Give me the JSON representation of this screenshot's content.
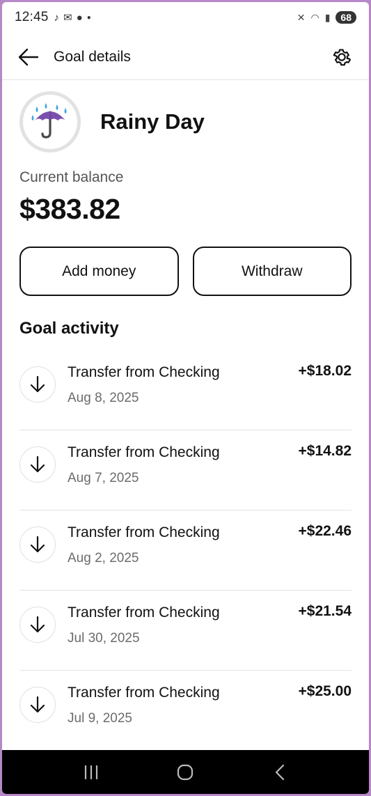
{
  "status_bar": {
    "time": "12:45",
    "battery": "68",
    "notification_icons": [
      "tiktok-icon",
      "mail-icon",
      "reddit-icon",
      "dot-icon"
    ],
    "system_icons": [
      "mute-icon",
      "wifi-icon",
      "signal-icon"
    ]
  },
  "app_bar": {
    "title": "Goal details"
  },
  "goal": {
    "name": "Rainy Day",
    "icon": "umbrella-rain-icon",
    "balance_label": "Current balance",
    "balance": "$383.82"
  },
  "actions": {
    "add_money_label": "Add money",
    "withdraw_label": "Withdraw"
  },
  "activity": {
    "title": "Goal activity",
    "items": [
      {
        "title": "Transfer from Checking",
        "date": "Aug 8, 2025",
        "amount": "+$18.02"
      },
      {
        "title": "Transfer from Checking",
        "date": "Aug 7, 2025",
        "amount": "+$14.82"
      },
      {
        "title": "Transfer from Checking",
        "date": "Aug 2, 2025",
        "amount": "+$22.46"
      },
      {
        "title": "Transfer from Checking",
        "date": "Jul 30, 2025",
        "amount": "+$21.54"
      },
      {
        "title": "Transfer from Checking",
        "date": "Jul 9, 2025",
        "amount": "+$25.00"
      }
    ]
  },
  "colors": {
    "background": "#ffffff",
    "text": "#111111",
    "muted": "#6b6b6b",
    "umbrella": "#7b4fae",
    "rain": "#3ea6e0"
  }
}
